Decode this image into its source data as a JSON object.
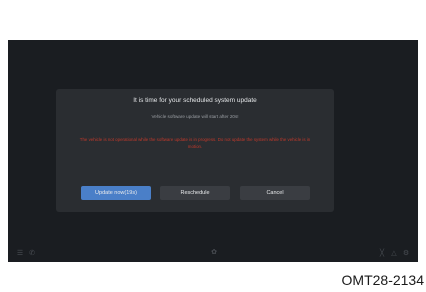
{
  "background": {
    "left_text": "",
    "right_text": ""
  },
  "dialog": {
    "title": "It is time for your scheduled system update",
    "subtitle": "Vehicle software update will start after 20s!",
    "warning": "The vehicle is not operational while the software update is in progress. Do not update the system while the vehicle is in motion.",
    "buttons": {
      "update": "Update now(19s)",
      "reschedule": "Reschedule",
      "cancel": "Cancel"
    },
    "warning_color": "#c0392b",
    "accent_color": "#4a7fc8"
  },
  "bottom_bar": {
    "icons": [
      "menu-icon",
      "phone-icon",
      "fan-icon",
      "seat-icon",
      "navigation-icon",
      "settings-icon"
    ]
  },
  "caption": "OMT28-2134"
}
